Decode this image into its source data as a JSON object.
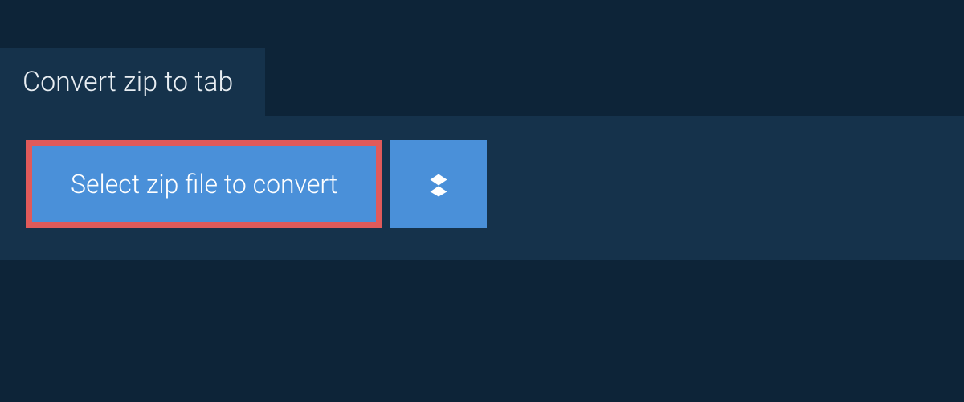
{
  "tab": {
    "title": "Convert zip to tab"
  },
  "actions": {
    "select_label": "Select zip file to convert"
  },
  "colors": {
    "background": "#0d2438",
    "panel": "#15324b",
    "button": "#4a90d9",
    "highlight_border": "#e05a5a",
    "text_light": "#ffffff"
  }
}
